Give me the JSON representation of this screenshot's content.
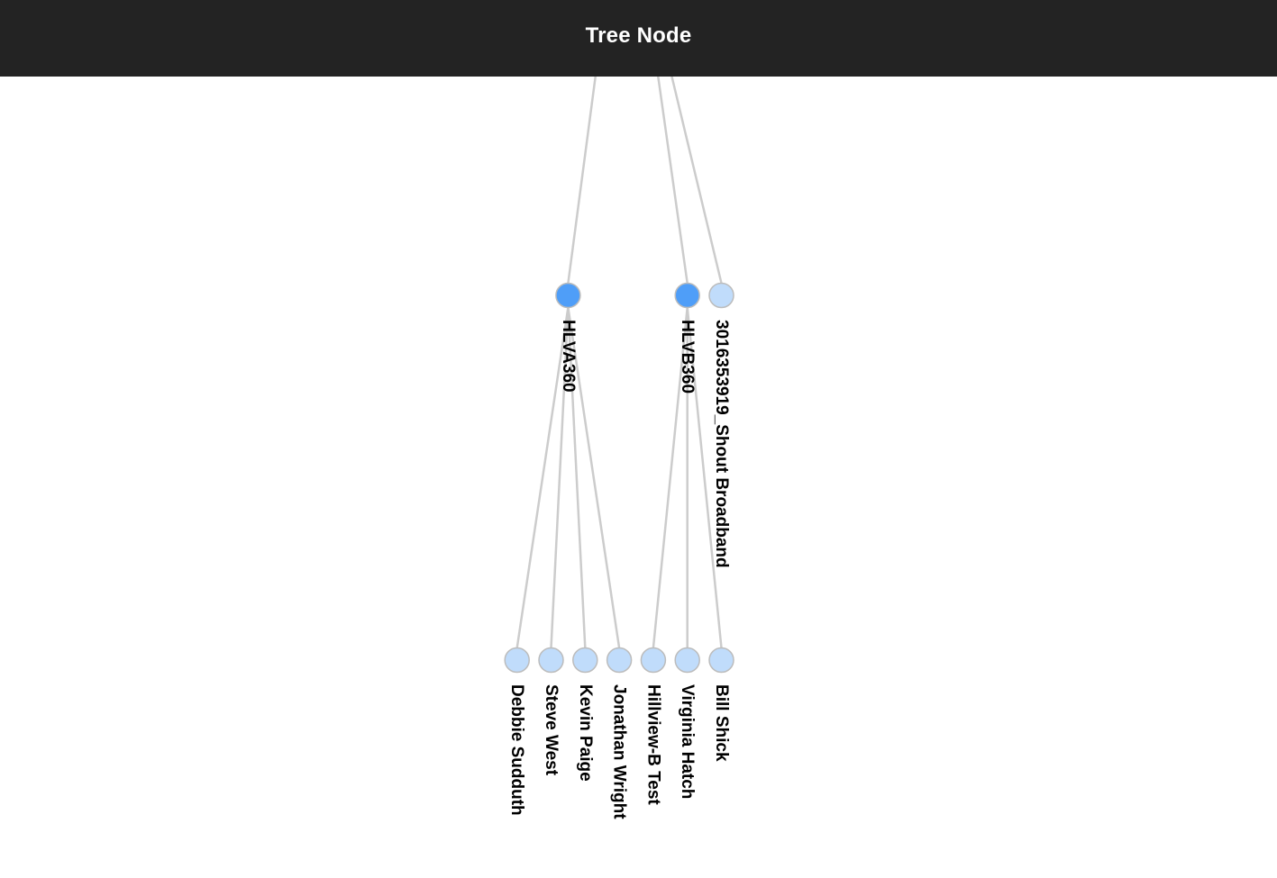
{
  "header": {
    "title": "Tree Node"
  },
  "colors": {
    "header_bg": "#232323",
    "link": "#cccccc",
    "expanded_node": "#4f9ef8",
    "leaf_node": "#c0dcfb",
    "node_stroke": "#bcbcbc"
  },
  "tree": {
    "root": "Tree Node",
    "children": [
      {
        "name": "HLVA360",
        "state": "expanded",
        "children": [
          {
            "name": "Debbie Sudduth",
            "state": "leaf"
          },
          {
            "name": "Steve West",
            "state": "leaf"
          },
          {
            "name": "Kevin Paige",
            "state": "leaf"
          },
          {
            "name": "Jonathan Wright",
            "state": "leaf"
          }
        ]
      },
      {
        "name": "HLVB360",
        "state": "expanded",
        "children": [
          {
            "name": "Hillview-B Test",
            "state": "leaf"
          },
          {
            "name": "Virginia Hatch",
            "state": "leaf"
          },
          {
            "name": "Bill Shick",
            "state": "leaf"
          }
        ]
      },
      {
        "name": "3016353919_Shout Broadband",
        "state": "leaf"
      }
    ]
  }
}
